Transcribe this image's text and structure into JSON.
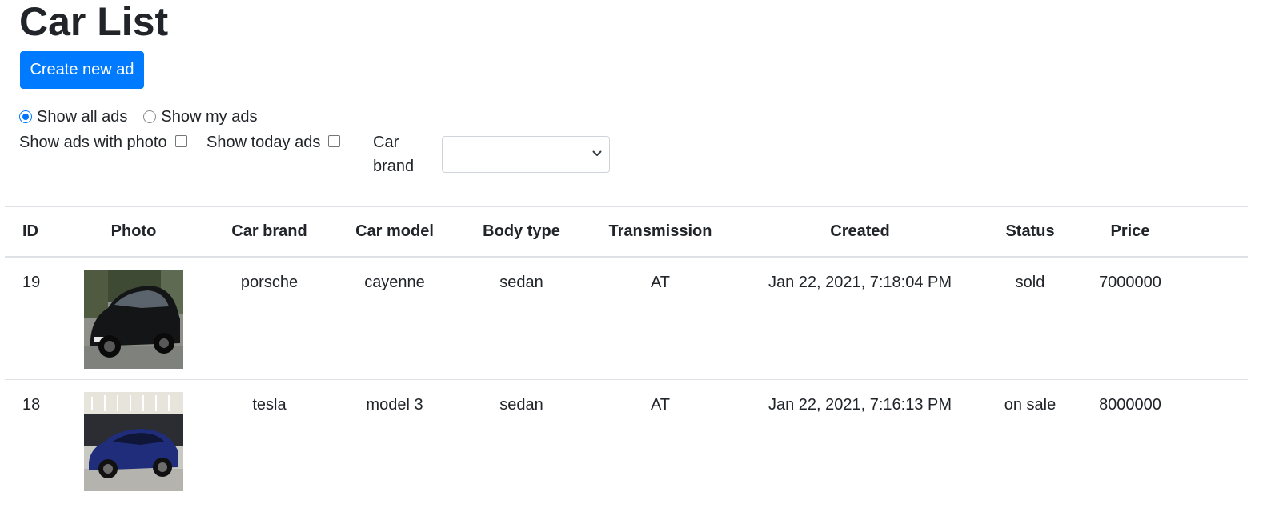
{
  "page": {
    "title": "Car List",
    "create_button_label": "Create new ad"
  },
  "filters": {
    "radio_all_label": "Show all ads",
    "radio_mine_label": "Show my ads",
    "radio_selected": "all",
    "with_photo_label": "Show ads with photo",
    "today_label": "Show today ads",
    "car_brand_label": "Car brand",
    "car_brand_selected": ""
  },
  "table": {
    "headers": {
      "id": "ID",
      "photo": "Photo",
      "brand": "Car brand",
      "model": "Car model",
      "body": "Body type",
      "transmission": "Transmission",
      "created": "Created",
      "status": "Status",
      "price": "Price"
    },
    "rows": [
      {
        "id": "19",
        "photo_icon": "black-porsche-cayenne-photo",
        "brand": "porsche",
        "model": "cayenne",
        "body": "sedan",
        "transmission": "AT",
        "created": "Jan 22, 2021, 7:18:04 PM",
        "status": "sold",
        "price": "7000000"
      },
      {
        "id": "18",
        "photo_icon": "blue-tesla-model-3-photo",
        "brand": "tesla",
        "model": "model 3",
        "body": "sedan",
        "transmission": "AT",
        "created": "Jan 22, 2021, 7:16:13 PM",
        "status": "on sale",
        "price": "8000000"
      }
    ]
  },
  "colors": {
    "primary": "#007bff",
    "text": "#212529",
    "border": "#dee2e6"
  }
}
